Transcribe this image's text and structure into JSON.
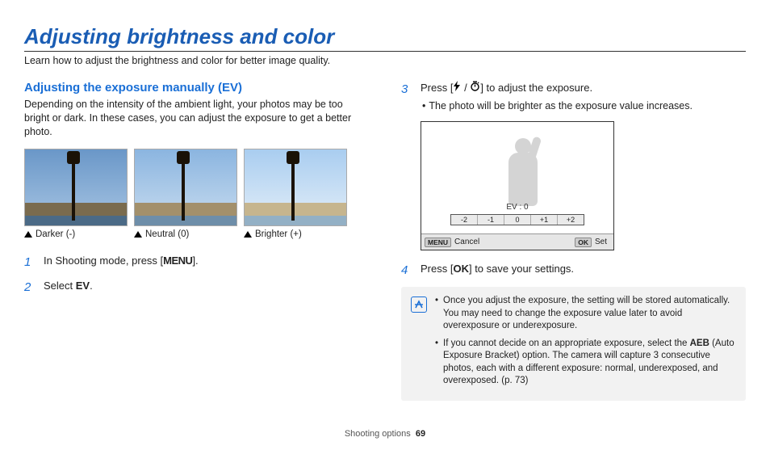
{
  "page": {
    "title": "Adjusting brightness and color",
    "intro": "Learn how to adjust the brightness and color for better image quality.",
    "footer_section": "Shooting options",
    "footer_page": "69"
  },
  "left": {
    "section_title": "Adjusting the exposure manually (EV)",
    "section_body": "Depending on the intensity of the ambient light, your photos may be too bright or dark. In these cases, you can adjust the exposure to get a better photo.",
    "captions": {
      "darker": "Darker (-)",
      "neutral": "Neutral (0)",
      "brighter": "Brighter (+)"
    },
    "steps": {
      "s1_pre": "In Shooting mode, press [",
      "s1_btn": "MENU",
      "s1_post": "].",
      "s2_pre": "Select ",
      "s2_bold": "EV",
      "s2_post": "."
    }
  },
  "right": {
    "s3_pre": "Press [",
    "s3_post": "] to adjust the exposure.",
    "s3_bullet": "The photo will be brighter as the exposure value increases.",
    "screen": {
      "ev_label": "EV : 0",
      "ticks": [
        "-2",
        "-1",
        "0",
        "+1",
        "+2"
      ],
      "cancel_btn": "MENU",
      "cancel_text": "Cancel",
      "set_btn": "OK",
      "set_text": "Set"
    },
    "s4_pre": "Press [",
    "s4_btn": "OK",
    "s4_post": "] to save your settings.",
    "notes": {
      "n1_pre": "Once you adjust the exposure, the setting will be stored automatically. You may need to change the exposure value later to avoid overexposure or underexposure.",
      "n2_pre": "If you cannot decide on an appropriate exposure, select the ",
      "n2_bold": "AEB",
      "n2_post": " (Auto Exposure Bracket) option. The camera will capture 3 consecutive photos, each with a different exposure: normal, underexposed, and overexposed. (p. 73)"
    }
  }
}
